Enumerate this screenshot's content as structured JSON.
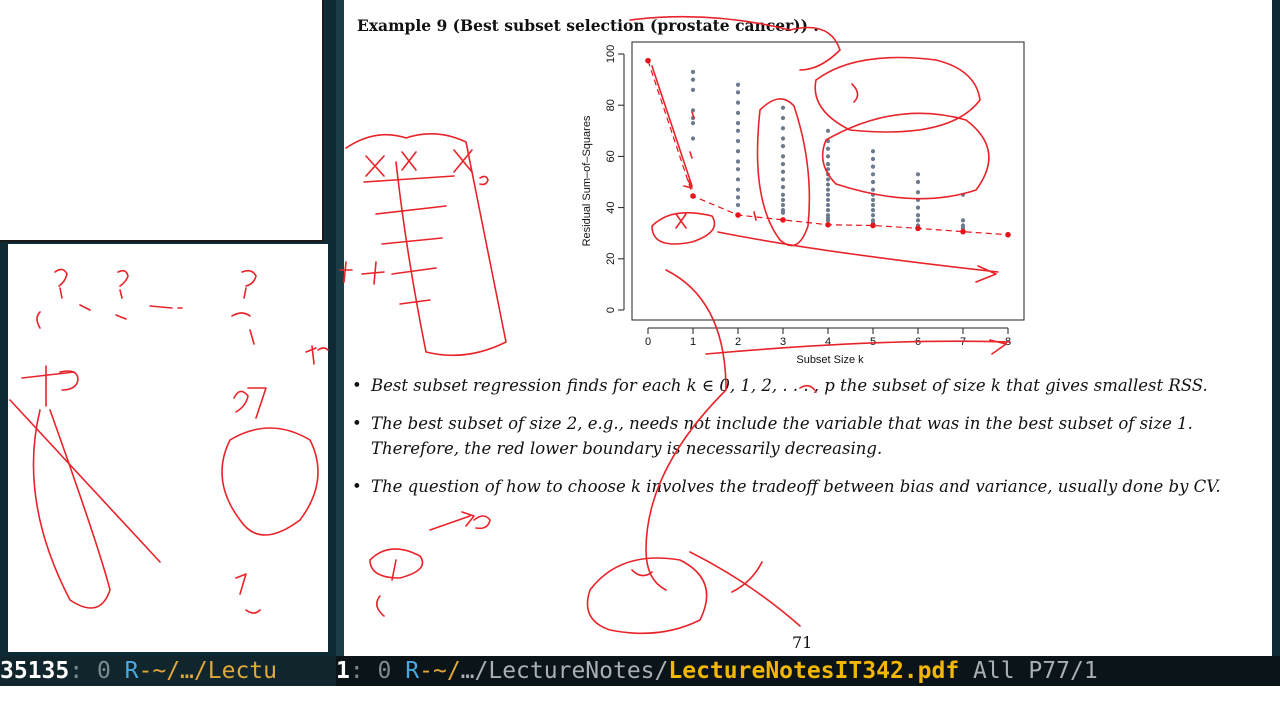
{
  "document": {
    "example_title": "Example 9 (Best subset selection (prostate cancer)) .",
    "bullets": [
      "Best subset regression finds for each k ∈ 0, 1, 2, . . . , p the subset of size k that gives smallest RSS.",
      "The best subset of size 2, e.g., needs not include the variable that was in the best subset of size 1.  Therefore, the red lower boundary is necessarily decreasing.",
      "The question of how to choose k involves the tradeoff between bias and variance, usually done by CV."
    ],
    "bullet_symbol": "•",
    "page_number": "71"
  },
  "chart_data": {
    "type": "scatter",
    "xlabel": "Subset Size k",
    "ylabel": "Residual Sum–of–Squares",
    "xlim": [
      0,
      8
    ],
    "ylim": [
      0,
      100
    ],
    "xticks": [
      "0",
      "1",
      "2",
      "3",
      "4",
      "5",
      "6",
      "7",
      "8"
    ],
    "yticks": [
      "0",
      "20",
      "40",
      "60",
      "80",
      "100"
    ],
    "series": [
      {
        "points": [
          [
            1,
            93
          ],
          [
            1,
            90
          ],
          [
            1,
            86
          ],
          [
            1,
            78
          ],
          [
            1,
            75
          ],
          [
            1,
            73
          ],
          [
            1,
            67
          ],
          [
            2,
            88
          ],
          [
            2,
            85
          ],
          [
            2,
            81
          ],
          [
            2,
            77
          ],
          [
            2,
            73
          ],
          [
            2,
            70
          ],
          [
            2,
            66
          ],
          [
            2,
            62
          ],
          [
            2,
            58
          ],
          [
            2,
            55
          ],
          [
            2,
            51
          ],
          [
            2,
            47
          ],
          [
            2,
            44
          ],
          [
            2,
            41
          ],
          [
            3,
            79
          ],
          [
            3,
            75
          ],
          [
            3,
            71
          ],
          [
            3,
            67
          ],
          [
            3,
            64
          ],
          [
            3,
            60
          ],
          [
            3,
            57
          ],
          [
            3,
            54
          ],
          [
            3,
            51
          ],
          [
            3,
            48
          ],
          [
            3,
            45
          ],
          [
            3,
            43
          ],
          [
            3,
            41
          ],
          [
            3,
            39
          ],
          [
            3,
            38
          ],
          [
            4,
            70
          ],
          [
            4,
            66
          ],
          [
            4,
            63
          ],
          [
            4,
            60
          ],
          [
            4,
            57
          ],
          [
            4,
            55
          ],
          [
            4,
            53
          ],
          [
            4,
            51
          ],
          [
            4,
            49
          ],
          [
            4,
            47
          ],
          [
            4,
            45
          ],
          [
            4,
            43
          ],
          [
            4,
            41
          ],
          [
            4,
            39
          ],
          [
            4,
            37
          ],
          [
            4,
            36
          ],
          [
            4,
            35
          ],
          [
            5,
            62
          ],
          [
            5,
            59
          ],
          [
            5,
            56
          ],
          [
            5,
            53
          ],
          [
            5,
            50
          ],
          [
            5,
            47
          ],
          [
            5,
            45
          ],
          [
            5,
            43
          ],
          [
            5,
            41
          ],
          [
            5,
            39
          ],
          [
            5,
            37
          ],
          [
            5,
            35
          ],
          [
            5,
            34
          ],
          [
            6,
            53
          ],
          [
            6,
            50
          ],
          [
            6,
            46
          ],
          [
            6,
            43
          ],
          [
            6,
            40
          ],
          [
            6,
            37
          ],
          [
            6,
            35
          ],
          [
            6,
            33
          ],
          [
            7,
            45
          ],
          [
            7,
            35
          ],
          [
            7,
            33
          ],
          [
            7,
            32
          ]
        ],
        "color": "#6b7a8c"
      },
      {
        "points": [
          [
            0,
            97.4
          ],
          [
            1,
            44.5
          ],
          [
            2,
            37.1
          ],
          [
            3,
            35.2
          ],
          [
            4,
            33.3
          ],
          [
            5,
            33.0
          ],
          [
            6,
            31.9
          ],
          [
            7,
            30.6
          ],
          [
            8,
            29.4
          ]
        ],
        "color": "#e8141b",
        "style": "dashed-line-with-points"
      }
    ],
    "grid": false,
    "legend": "none"
  },
  "modeline": {
    "left": {
      "window_number": "35135",
      "separator": ": 0",
      "mode_letter": "R",
      "path": "-~/…/Lectu"
    },
    "right": {
      "window_number": "1",
      "separator": ": 0",
      "mode_letter": "R",
      "path_prefix": "-~/",
      "path": "…/LectureNotes/",
      "filename": "LectureNotesIT342.pdf",
      "position": "All P77/1"
    },
    "colors": {
      "background": "#0b1418",
      "filename": "#f2b705",
      "path": "#4aa8e0"
    }
  },
  "annotations": {
    "ink_color": "#e8242a"
  }
}
